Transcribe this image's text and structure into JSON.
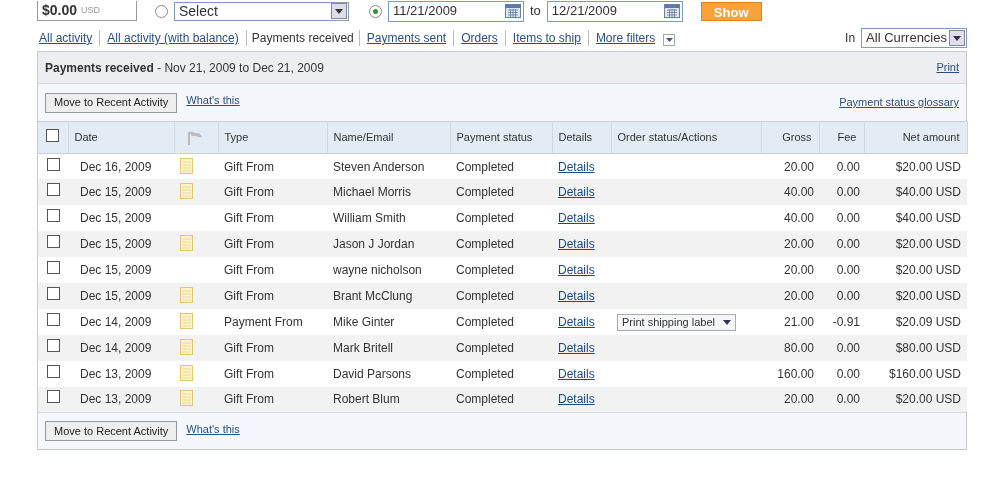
{
  "search_bar": {
    "amount": "$0.00",
    "currency": "USD",
    "options": [
      {
        "kind": "select",
        "selected": false,
        "value": "Select"
      },
      {
        "kind": "dates",
        "selected": true,
        "from": "11/21/2009",
        "to_label": "to",
        "to": "12/21/2009"
      }
    ],
    "show_button": "Show"
  },
  "tabs": [
    {
      "label": "All activity",
      "selected": false
    },
    {
      "label": "All activity (with balance)",
      "selected": false
    },
    {
      "label": "Payments received",
      "selected": true
    },
    {
      "label": "Payments sent",
      "selected": false
    },
    {
      "label": "Orders",
      "selected": false
    },
    {
      "label": "Items to ship",
      "selected": false
    },
    {
      "label": "More filters",
      "selected": false
    }
  ],
  "currency": {
    "label": "In",
    "value": "All Currencies"
  },
  "panel": {
    "title": "Payments received",
    "range": " - Nov 21, 2009 to Dec 21, 2009",
    "print": "Print",
    "move_button": "Move to Recent Activity",
    "whats_this": "What's this",
    "glossary": "Payment status glossary"
  },
  "table": {
    "select_all": false,
    "columns": [
      "Date",
      "Type",
      "Name/Email",
      "Payment status",
      "Details",
      "Order status/Actions",
      "Gross",
      "Fee",
      "Net amount"
    ],
    "rows": [
      {
        "checked": false,
        "note": true,
        "date": "Dec 16, 2009",
        "type": "Gift From",
        "name": "Steven Anderson",
        "status": "Completed",
        "details": "Details",
        "gross": "20.00",
        "fee": "0.00",
        "net": "$20.00 USD"
      },
      {
        "checked": false,
        "note": true,
        "date": "Dec 15, 2009",
        "type": "Gift From",
        "name": "Michael Morris",
        "status": "Completed",
        "details": "Details",
        "gross": "40.00",
        "fee": "0.00",
        "net": "$40.00 USD"
      },
      {
        "checked": false,
        "note": false,
        "date": "Dec 15, 2009",
        "type": "Gift From",
        "name": "William Smith",
        "status": "Completed",
        "details": "Details",
        "gross": "40.00",
        "fee": "0.00",
        "net": "$40.00 USD"
      },
      {
        "checked": false,
        "note": true,
        "date": "Dec 15, 2009",
        "type": "Gift From",
        "name": "Jason J Jordan",
        "status": "Completed",
        "details": "Details",
        "gross": "20.00",
        "fee": "0.00",
        "net": "$20.00 USD"
      },
      {
        "checked": false,
        "note": false,
        "date": "Dec 15, 2009",
        "type": "Gift From",
        "name": "wayne nicholson",
        "status": "Completed",
        "details": "Details",
        "gross": "20.00",
        "fee": "0.00",
        "net": "$20.00 USD"
      },
      {
        "checked": false,
        "note": true,
        "date": "Dec 15, 2009",
        "type": "Gift From",
        "name": "Brant McClung",
        "status": "Completed",
        "details": "Details",
        "gross": "20.00",
        "fee": "0.00",
        "net": "$20.00 USD"
      },
      {
        "checked": false,
        "note": true,
        "date": "Dec 14, 2009",
        "type": "Payment From",
        "name": "Mike Ginter",
        "status": "Completed",
        "details": "Details",
        "action": "Print shipping label",
        "gross": "21.00",
        "fee": "-0.91",
        "net": "$20.09 USD"
      },
      {
        "checked": false,
        "note": true,
        "date": "Dec 14, 2009",
        "type": "Gift From",
        "name": "Mark Britell",
        "status": "Completed",
        "details": "Details",
        "gross": "80.00",
        "fee": "0.00",
        "net": "$80.00 USD"
      },
      {
        "checked": false,
        "note": true,
        "date": "Dec 13, 2009",
        "type": "Gift From",
        "name": "David Parsons",
        "status": "Completed",
        "details": "Details",
        "gross": "160.00",
        "fee": "0.00",
        "net": "$160.00 USD"
      },
      {
        "checked": false,
        "note": true,
        "date": "Dec 13, 2009",
        "type": "Gift From",
        "name": "Robert Blum",
        "status": "Completed",
        "details": "Details",
        "gross": "20.00",
        "fee": "0.00",
        "net": "$20.00 USD"
      }
    ]
  },
  "footer": {
    "move_button": "Move to Recent Activity",
    "whats_this": "What's this"
  }
}
